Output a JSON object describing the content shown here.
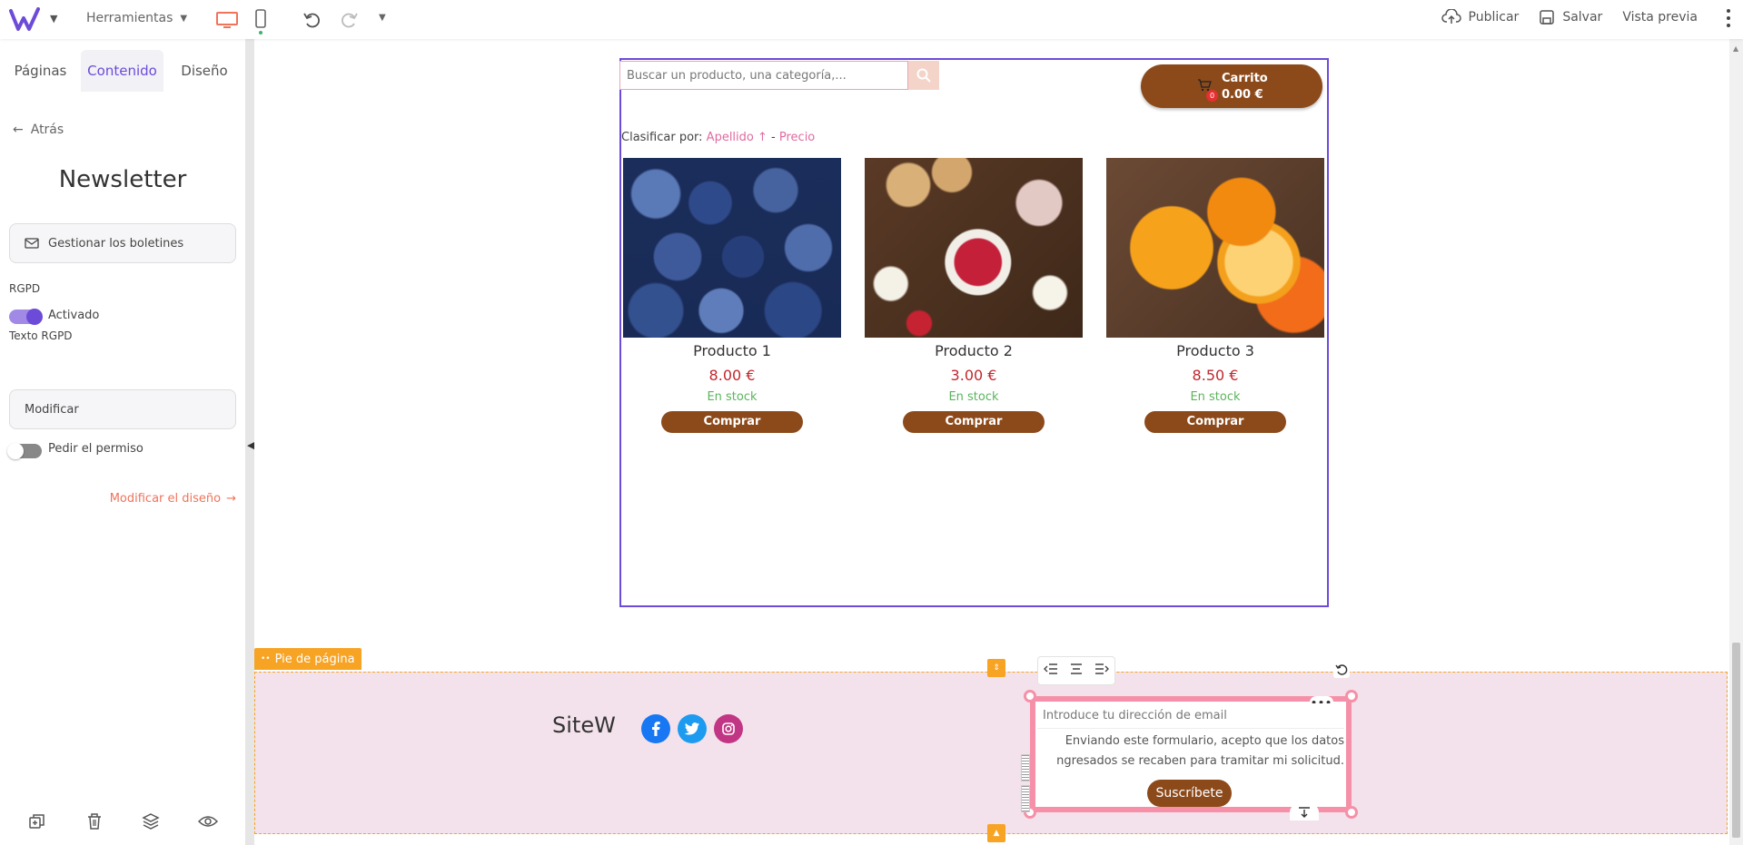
{
  "topbar": {
    "tools_label": "Herramientas",
    "publish_label": "Publicar",
    "save_label": "Salvar",
    "preview_label": "Vista previa"
  },
  "sidebar": {
    "tabs": [
      {
        "label": "Páginas"
      },
      {
        "label": "Contenido"
      },
      {
        "label": "Diseño"
      }
    ],
    "back_label": "Atrás",
    "title": "Newsletter",
    "manage_label": "Gestionar los boletines",
    "rgpd_label": "RGPD",
    "rgpd_toggle_label": "Activado",
    "rgpd_text_label": "Texto RGPD",
    "modify_label": "Modificar",
    "permission_label": "Pedir el permiso",
    "design_link_label": "Modificar el diseño"
  },
  "shop": {
    "search_placeholder": "Buscar un producto, una categoría,...",
    "cart_title": "Carrito",
    "cart_total": "0.00 €",
    "cart_count": "0",
    "sort_label": "Clasificar por:",
    "sort_option_1": "Apellido ↑",
    "sort_sep": "-",
    "sort_option_2": "Precio",
    "products": [
      {
        "name": "Producto 1",
        "price": "8.00 €",
        "stock": "En stock",
        "buy": "Comprar"
      },
      {
        "name": "Producto 2",
        "price": "3.00 €",
        "stock": "En stock",
        "buy": "Comprar"
      },
      {
        "name": "Producto 3",
        "price": "8.50 €",
        "stock": "En stock",
        "buy": "Comprar"
      }
    ]
  },
  "footer": {
    "tag_label": "Pie de página",
    "brand": "SiteW",
    "email_placeholder": "Introduce tu dirección de email",
    "consent_line1": "Enviando este formulario, acepto que los datos",
    "consent_line2": "ngresados se recaben para tramitar mi solicitud.",
    "subscribe_label": "Suscríbete"
  },
  "colors": {
    "accent": "#6c4bd8",
    "brand_brown": "#8c4a1b",
    "price_red": "#c0282f",
    "stock_green": "#5bb45b",
    "footer_bg": "#f3e2eb",
    "selection_orange": "#f7a323",
    "newsletter_pink": "#f590a8"
  }
}
